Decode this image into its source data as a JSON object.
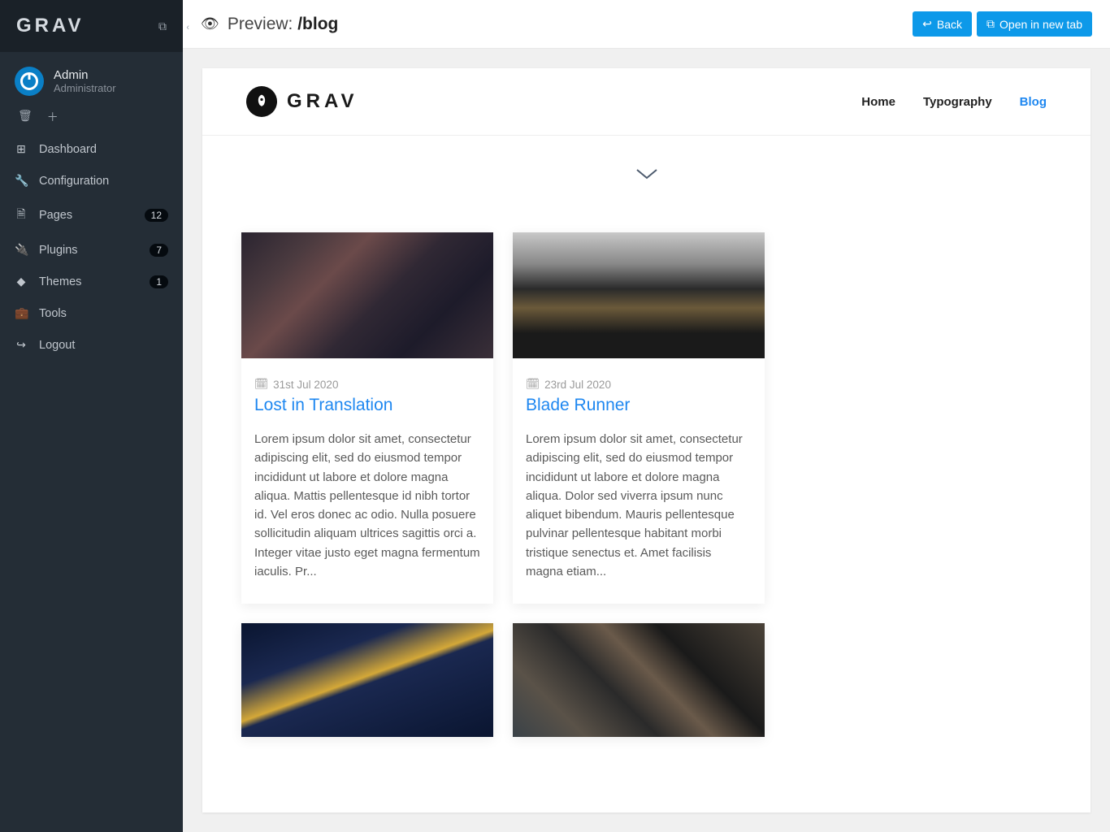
{
  "brand": "GRAV",
  "user": {
    "name": "Admin",
    "role": "Administrator"
  },
  "sidebar": {
    "items": [
      {
        "label": "Dashboard",
        "icon": "⊞"
      },
      {
        "label": "Configuration",
        "icon": "🔧"
      },
      {
        "label": "Pages",
        "icon": "🗎",
        "badge": "12"
      },
      {
        "label": "Plugins",
        "icon": "🔌",
        "badge": "7"
      },
      {
        "label": "Themes",
        "icon": "◆",
        "badge": "1"
      },
      {
        "label": "Tools",
        "icon": "💼"
      },
      {
        "label": "Logout",
        "icon": "↪"
      }
    ]
  },
  "topbar": {
    "preview_label": "Preview: ",
    "path": "/blog",
    "back_label": "Back",
    "open_label": "Open in new tab"
  },
  "site": {
    "brand": "GRAV",
    "nav": [
      {
        "label": "Home",
        "active": false
      },
      {
        "label": "Typography",
        "active": false
      },
      {
        "label": "Blog",
        "active": true
      }
    ]
  },
  "posts": [
    {
      "date": "31st Jul 2020",
      "title": "Lost in Translation",
      "excerpt": "Lorem ipsum dolor sit amet, consectetur adipiscing elit, sed do eiusmod tempor incididunt ut labore et dolore magna aliqua. Mattis pellentesque id nibh tortor id. Vel eros donec ac odio. Nulla posuere sollicitudin aliquam ultrices sagittis orci a. Integer vitae justo eget magna fermentum iaculis. Pr..."
    },
    {
      "date": "23rd Jul 2020",
      "title": "Blade Runner",
      "excerpt": "Lorem ipsum dolor sit amet, consectetur adipiscing elit, sed do eiusmod tempor incididunt ut labore et dolore magna aliqua. Dolor sed viverra ipsum nunc aliquet bibendum. Mauris pellentesque pulvinar pellentesque habitant morbi tristique senectus et. Amet facilisis magna etiam..."
    }
  ]
}
